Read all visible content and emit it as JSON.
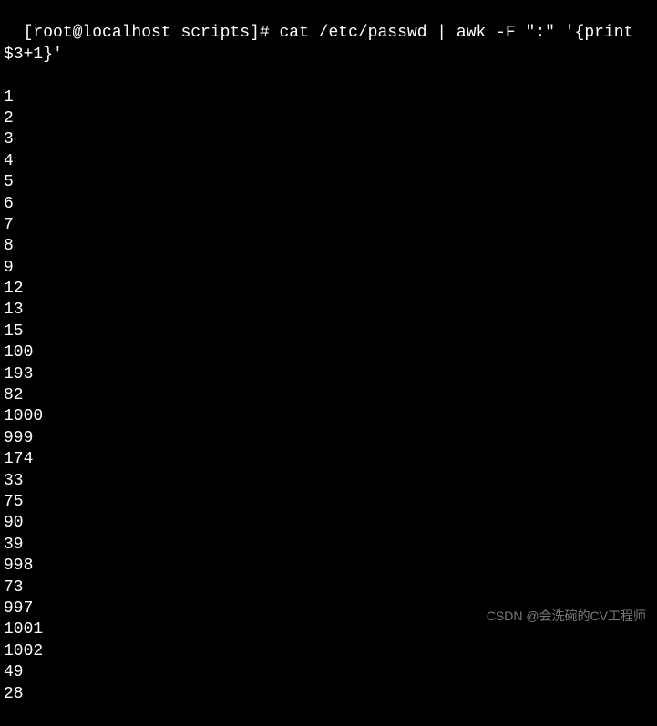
{
  "terminal": {
    "prompt": "[root@localhost scripts]# ",
    "command": "cat /etc/passwd | awk -F \":\" '{print $3+1}'",
    "output": [
      "1",
      "2",
      "3",
      "4",
      "5",
      "6",
      "7",
      "8",
      "9",
      "12",
      "13",
      "15",
      "100",
      "193",
      "82",
      "1000",
      "999",
      "174",
      "33",
      "75",
      "90",
      "39",
      "998",
      "73",
      "997",
      "1001",
      "1002",
      "49",
      "28"
    ]
  },
  "watermark": "CSDN @会洗碗的CV工程师"
}
